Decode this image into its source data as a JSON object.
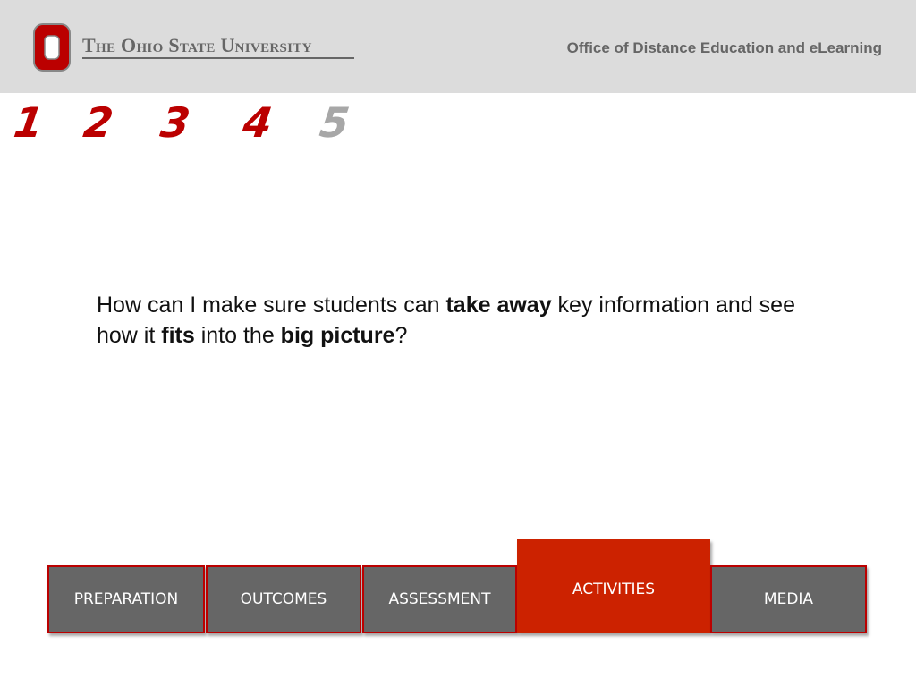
{
  "header": {
    "university_name": "The Ohio State University",
    "office_name": "Office of Distance Education and eLearning"
  },
  "steps": [
    {
      "label": "1",
      "state": "active"
    },
    {
      "label": "2",
      "state": "active"
    },
    {
      "label": "3",
      "state": "active"
    },
    {
      "label": "4",
      "state": "active"
    },
    {
      "label": "5",
      "state": "inactive"
    }
  ],
  "question": {
    "segments": [
      {
        "text": "How can I make sure students can ",
        "bold": false
      },
      {
        "text": "take away",
        "bold": true
      },
      {
        "text": " key information and see how it ",
        "bold": false
      },
      {
        "text": "fits",
        "bold": true
      },
      {
        "text": " into the ",
        "bold": false
      },
      {
        "text": "big picture",
        "bold": true
      },
      {
        "text": "?",
        "bold": false
      }
    ]
  },
  "tabs": [
    {
      "label": "PREPARATION",
      "active": false
    },
    {
      "label": "OUTCOMES",
      "active": false
    },
    {
      "label": "ASSESSMENT",
      "active": false
    },
    {
      "label": "ACTIVITIES",
      "active": true
    },
    {
      "label": "MEDIA",
      "active": false
    }
  ],
  "colors": {
    "scarlet": "#bb0000",
    "gray": "#666666",
    "active_tab": "#cc2200",
    "header_bg": "#dcdcdc"
  },
  "icons": {
    "logo": "block-o-logo-icon"
  }
}
